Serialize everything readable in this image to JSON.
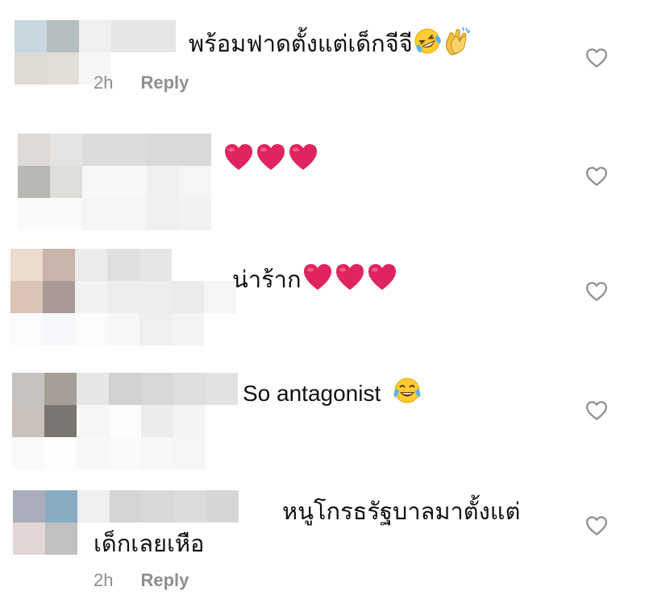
{
  "colors": {
    "text": "#111111",
    "meta": "#8e8e8e",
    "heart_outline": "#8e8e8e",
    "emoji_heart": "#e0245e"
  },
  "comments": [
    {
      "text": "พร้อมฟาดตั้งแต่เด็กจีจี",
      "emojis": [
        "rolling-on-floor-laughing",
        "clapping-hands"
      ],
      "time": "2h",
      "reply": "Reply",
      "mosaic": [
        [
          "#c8d7df",
          "#b5bfbf",
          "#efefef",
          "#e6e6e6",
          "#e6e6e6",
          "#ffffff",
          "#ffffff"
        ],
        [
          "#dedbd4",
          "#e2ddd6",
          "#f6f6f6",
          "#ffffff",
          "#ffffff",
          "#ffffff",
          "#ffffff"
        ],
        [
          "#ffffff",
          "#ffffff",
          "#ffffff",
          "#ffffff",
          "#ffffff",
          "#ffffff",
          "#ffffff"
        ]
      ]
    },
    {
      "text": "",
      "emojis": [
        "red-heart",
        "red-heart",
        "red-heart"
      ],
      "mosaic": [
        [
          "#dedad6",
          "#e6e4e3",
          "#dcdcdc",
          "#dcdcdc",
          "#d9d9d9",
          "#d9d9d9",
          "#ffffff"
        ],
        [
          "#b7b9b5",
          "#dcdfda",
          "#f8f8f8",
          "#f8f8f8",
          "#efefef",
          "#f5f5f5",
          "#ffffff"
        ],
        [
          "#fafafa",
          "#fafafa",
          "#f5f5f5",
          "#f5f5f5",
          "#efefef",
          "#f2f2f2",
          "#ffffff"
        ]
      ]
    },
    {
      "text": "น่าร้าก",
      "emojis": [
        "red-heart",
        "red-heart",
        "red-heart"
      ],
      "mosaic": [
        [
          "#ebdccd",
          "#c8b4a8",
          "#ececec",
          "#e0e0e0",
          "#e6e6e6",
          "#ffffff",
          "#ffffff"
        ],
        [
          "#d9c4b6",
          "#a99a97",
          "#f2f2f2",
          "#ededed",
          "#ededed",
          "#ebebeb",
          "#f5f5f5"
        ],
        [
          "#fbfbfd",
          "#f6f7fb",
          "#fbfbfb",
          "#f7f7f7",
          "#efefef",
          "#f4f4f4",
          "#ffffff"
        ]
      ]
    },
    {
      "text": "So antagonist",
      "emojis": [
        "face-with-tears-of-joy"
      ],
      "mosaic": [
        [
          "#c6c2bf",
          "#a59f97",
          "#e6e6e6",
          "#d1d1d1",
          "#d7d7d7",
          "#dedede",
          "#e2e2e2"
        ],
        [
          "#c9c2bc",
          "#7a7672",
          "#f6f6f6",
          "#fcfcfc",
          "#ececec",
          "#f4f4f4",
          "#ffffff"
        ],
        [
          "#fafafa",
          "#fdfdfd",
          "#f8f8f8",
          "#fafafa",
          "#f7f7f7",
          "#f5f5f5",
          "#ffffff"
        ]
      ]
    },
    {
      "text": "หนูโกรธรัฐบาลมาตั้งแต่เด็กเลยเหือ",
      "emojis": [],
      "time": "2h",
      "reply": "Reply",
      "mosaic": [
        [
          "#a9adbb",
          "#88acc3",
          "#efefef",
          "#d5d5d5",
          "#d8d8d8",
          "#dcdcdc",
          "#d6d6d6"
        ],
        [
          "#e2d7d6",
          "#c2c0c1",
          "#ffffff",
          "#ffffff",
          "#ffffff",
          "#ffffff",
          "#ffffff"
        ],
        [
          "#ffffff",
          "#ffffff",
          "#ffffff",
          "#ffffff",
          "#ffffff",
          "#ffffff",
          "#ffffff"
        ]
      ]
    }
  ]
}
